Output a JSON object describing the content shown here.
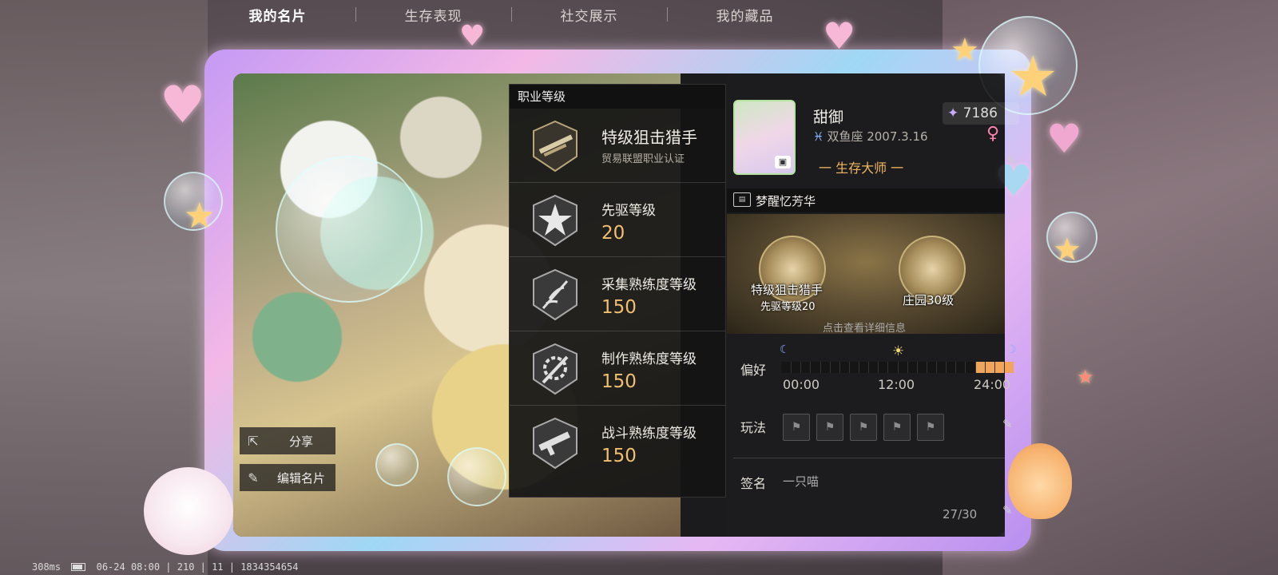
{
  "tabs": [
    {
      "label": "我的名片",
      "active": true
    },
    {
      "label": "生存表现",
      "active": false
    },
    {
      "label": "社交展示",
      "active": false
    },
    {
      "label": "我的藏品",
      "active": false
    }
  ],
  "actions": {
    "share_label": "分享",
    "edit_label": "编辑名片"
  },
  "career": {
    "header": "职业等级",
    "items": [
      {
        "title": "特级狙击猎手",
        "subtitle": "贸易联盟职业认证",
        "icon": "sniper-rifle-icon"
      },
      {
        "title": "先驱等级",
        "value": "20",
        "icon": "pioneer-star-icon"
      },
      {
        "title": "采集熟练度等级",
        "value": "150",
        "icon": "gathering-icon"
      },
      {
        "title": "制作熟练度等级",
        "value": "150",
        "icon": "crafting-gear-icon"
      },
      {
        "title": "战斗熟练度等级",
        "value": "150",
        "icon": "combat-gun-icon"
      }
    ]
  },
  "profile": {
    "name": "甜御",
    "points": "7186",
    "zodiac": "双鱼座 2007.3.16",
    "gender": "♀",
    "title": "一 生存大师 一",
    "section_name": "梦醒忆芳华",
    "emblems": [
      {
        "title": "特级狙击猎手",
        "sub": "先驱等级20",
        "icon": "sniper-emblem-icon"
      },
      {
        "title": "庄园30级",
        "sub": "",
        "icon": "manor-house-icon"
      }
    ],
    "hint": "点击查看详细信息",
    "preference_label": "偏好",
    "times": [
      "00:00",
      "12:00",
      "24:00"
    ],
    "preference_active_hours": [
      20,
      24
    ],
    "playstyle_label": "玩法",
    "signature_label": "签名",
    "signature": "一只喵",
    "signature_count": "27/30"
  },
  "status_bar": {
    "ping": "308ms",
    "datetime": "06-24 08:00 | 210 | 11 | 1834354654"
  },
  "colors": {
    "accent_gold": "#f0c070",
    "title_orange": "#f0b860",
    "timeline_fill": "#f0a55a",
    "frame_pink": "#f3b8e6",
    "frame_purple": "#c59af5"
  }
}
